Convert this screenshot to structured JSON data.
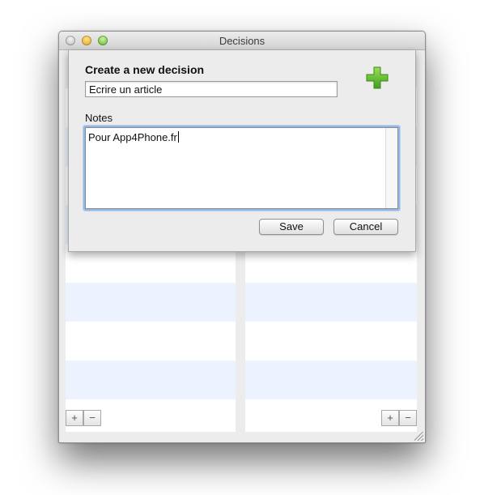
{
  "window": {
    "title": "Decisions"
  },
  "sheet": {
    "title": "Create a new decision",
    "name_value": "Ecrire un article",
    "notes_label": "Notes",
    "notes_value": "Pour App4Phone.fr",
    "save_label": "Save",
    "cancel_label": "Cancel",
    "add_icon": "green-plus-icon"
  },
  "footer": {
    "left_add": "+",
    "left_remove": "−",
    "right_add": "+",
    "right_remove": "−"
  },
  "colors": {
    "row_alt": "#edf3fe",
    "focus_ring": "#93b8e6",
    "add_icon_green": "#5bbf2a"
  }
}
